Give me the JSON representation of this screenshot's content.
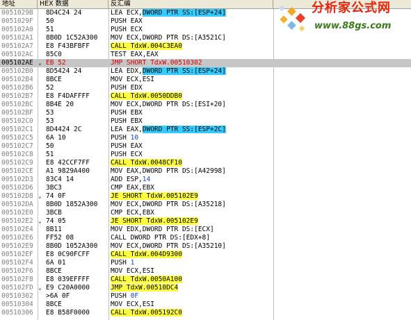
{
  "header": {
    "address": "地址",
    "hex": "HEX 数据",
    "disasm": "反汇编",
    "comment": ""
  },
  "watermark": {
    "title": "分析家公式网",
    "url": "www.88gs.com",
    "colors": {
      "title": "#e8240c",
      "url": "#3a7a1a"
    }
  },
  "colors": {
    "call_highlight": "#ffff40",
    "jump_highlight": "#ffff40",
    "stack_highlight": "#33ccff",
    "selection": "#c6c6c6"
  },
  "rows": [
    {
      "addr": "0051029B",
      "mark": "",
      "hex": "8D4C24 24",
      "parts": [
        {
          "t": "LEA ECX,"
        },
        {
          "t": "DWORD PTR SS:[ESP+24]",
          "c": "cyan"
        }
      ]
    },
    {
      "addr": "0051029F",
      "mark": "",
      "hex": "50",
      "parts": [
        {
          "t": "PUSH EAX"
        }
      ]
    },
    {
      "addr": "005102A0",
      "mark": "",
      "hex": "51",
      "parts": [
        {
          "t": "PUSH ECX"
        }
      ]
    },
    {
      "addr": "005102A1",
      "mark": "",
      "hex": "8B0D 1C52A300",
      "parts": [
        {
          "t": "MOV ECX,DWORD PTR DS:[A3521C]"
        }
      ]
    },
    {
      "addr": "005102A7",
      "mark": "",
      "hex": "E8 F43BFBFF",
      "parts": [
        {
          "t": "CALL TdxW.004C3EA0",
          "c": "yellow"
        }
      ]
    },
    {
      "addr": "005102AC",
      "mark": "",
      "hex": "85C0",
      "parts": [
        {
          "t": "TEST EAX,EAX"
        }
      ]
    },
    {
      "addr": "005102AE",
      "mark": "⌄",
      "hex": "EB 52",
      "selected": true,
      "parts": [
        {
          "t": "JMP SHORT TdxW.00510302",
          "c": "red"
        }
      ]
    },
    {
      "addr": "005102B0",
      "mark": "",
      "hex": "8D5424 24",
      "parts": [
        {
          "t": "LEA EDX,"
        },
        {
          "t": "DWORD PTR SS:[ESP+24]",
          "c": "cyan"
        }
      ]
    },
    {
      "addr": "005102B4",
      "mark": "",
      "hex": "8BCE",
      "parts": [
        {
          "t": "MOV ECX,ESI"
        }
      ]
    },
    {
      "addr": "005102B6",
      "mark": "",
      "hex": "52",
      "parts": [
        {
          "t": "PUSH EDX"
        }
      ]
    },
    {
      "addr": "005102B7",
      "mark": "",
      "hex": "E8 F4DAFFFF",
      "parts": [
        {
          "t": "CALL TdxW.0050DDB0",
          "c": "yellow"
        }
      ]
    },
    {
      "addr": "005102BC",
      "mark": "",
      "hex": "8B4E 20",
      "parts": [
        {
          "t": "MOV ECX,DWORD PTR DS:[ESI+20]"
        }
      ]
    },
    {
      "addr": "005102BF",
      "mark": "",
      "hex": "53",
      "parts": [
        {
          "t": "PUSH EBX"
        }
      ]
    },
    {
      "addr": "005102C0",
      "mark": "",
      "hex": "53",
      "parts": [
        {
          "t": "PUSH EBX"
        }
      ]
    },
    {
      "addr": "005102C1",
      "mark": "",
      "hex": "8D4424 2C",
      "parts": [
        {
          "t": "LEA EAX,"
        },
        {
          "t": "DWORD PTR SS:[ESP+2C]",
          "c": "cyan"
        }
      ]
    },
    {
      "addr": "005102C5",
      "mark": "",
      "hex": "6A 10",
      "parts": [
        {
          "t": "PUSH "
        },
        {
          "t": "10",
          "c": "blue"
        }
      ]
    },
    {
      "addr": "005102C7",
      "mark": "",
      "hex": "50",
      "parts": [
        {
          "t": "PUSH EAX"
        }
      ]
    },
    {
      "addr": "005102C8",
      "mark": "",
      "hex": "51",
      "parts": [
        {
          "t": "PUSH ECX"
        }
      ]
    },
    {
      "addr": "005102C9",
      "mark": "",
      "hex": "E8 42CCF7FF",
      "parts": [
        {
          "t": "CALL TdxW.0048CF10",
          "c": "yellow"
        }
      ]
    },
    {
      "addr": "005102CE",
      "mark": "",
      "hex": "A1 9829A400",
      "parts": [
        {
          "t": "MOV EAX,DWORD PTR DS:[A42998]"
        }
      ]
    },
    {
      "addr": "005102D3",
      "mark": "",
      "hex": "83C4 14",
      "parts": [
        {
          "t": "ADD ESP,"
        },
        {
          "t": "14",
          "c": "blue"
        }
      ]
    },
    {
      "addr": "005102D6",
      "mark": "",
      "hex": "3BC3",
      "parts": [
        {
          "t": "CMP EAX,EBX"
        }
      ]
    },
    {
      "addr": "005102D8",
      "mark": "⌄",
      "hex": "74 0F",
      "parts": [
        {
          "t": "JE SHORT TdxW.005102E9",
          "c": "yellow"
        }
      ]
    },
    {
      "addr": "005102DA",
      "mark": "",
      "hex": "8B0D 1852A300",
      "parts": [
        {
          "t": "MOV ECX,DWORD PTR DS:[A35218]"
        }
      ]
    },
    {
      "addr": "005102E0",
      "mark": "",
      "hex": "3BCB",
      "parts": [
        {
          "t": "CMP ECX,EBX"
        }
      ]
    },
    {
      "addr": "005102E2",
      "mark": "⌄",
      "hex": "74 05",
      "parts": [
        {
          "t": "JE SHORT TdxW.005102E9",
          "c": "yellow"
        }
      ]
    },
    {
      "addr": "005102E4",
      "mark": "",
      "hex": "8B11",
      "parts": [
        {
          "t": "MOV EDX,DWORD PTR DS:[ECX]"
        }
      ]
    },
    {
      "addr": "005102E6",
      "mark": "",
      "hex": "FF52 08",
      "parts": [
        {
          "t": "CALL DWORD PTR DS:[EDX+8]"
        }
      ]
    },
    {
      "addr": "005102E9",
      "mark": "",
      "hex": "8B0D 1052A300",
      "parts": [
        {
          "t": "MOV ECX,DWORD PTR DS:[A35210]"
        }
      ]
    },
    {
      "addr": "005102EF",
      "mark": "",
      "hex": "E8 0C90FCFF",
      "parts": [
        {
          "t": "CALL TdxW.004D9300",
          "c": "yellow"
        }
      ]
    },
    {
      "addr": "005102F4",
      "mark": "",
      "hex": "6A 01",
      "parts": [
        {
          "t": "PUSH "
        },
        {
          "t": "1",
          "c": "blue"
        }
      ]
    },
    {
      "addr": "005102F6",
      "mark": "",
      "hex": "8BCE",
      "parts": [
        {
          "t": "MOV ECX,ESI"
        }
      ]
    },
    {
      "addr": "005102F8",
      "mark": "",
      "hex": "E8 039EFFFF",
      "parts": [
        {
          "t": "CALL TdxW.0050A100",
          "c": "yellow"
        }
      ]
    },
    {
      "addr": "005102FD",
      "mark": "⌄",
      "hex": "E9 C20A0000",
      "parts": [
        {
          "t": "JMP TdxW.00510DC4",
          "c": "yellow"
        }
      ]
    },
    {
      "addr": "00510302",
      "mark": "",
      "hex": ">6A 0F",
      "parts": [
        {
          "t": "PUSH "
        },
        {
          "t": "0F",
          "c": "blue"
        }
      ]
    },
    {
      "addr": "00510304",
      "mark": "",
      "hex": "8BCE",
      "parts": [
        {
          "t": "MOV ECX,ESI"
        }
      ]
    },
    {
      "addr": "00510306",
      "mark": "",
      "hex": "E8 B58F0000",
      "parts": [
        {
          "t": "CALL TdxW.005192C0",
          "c": "yellow"
        }
      ]
    }
  ]
}
